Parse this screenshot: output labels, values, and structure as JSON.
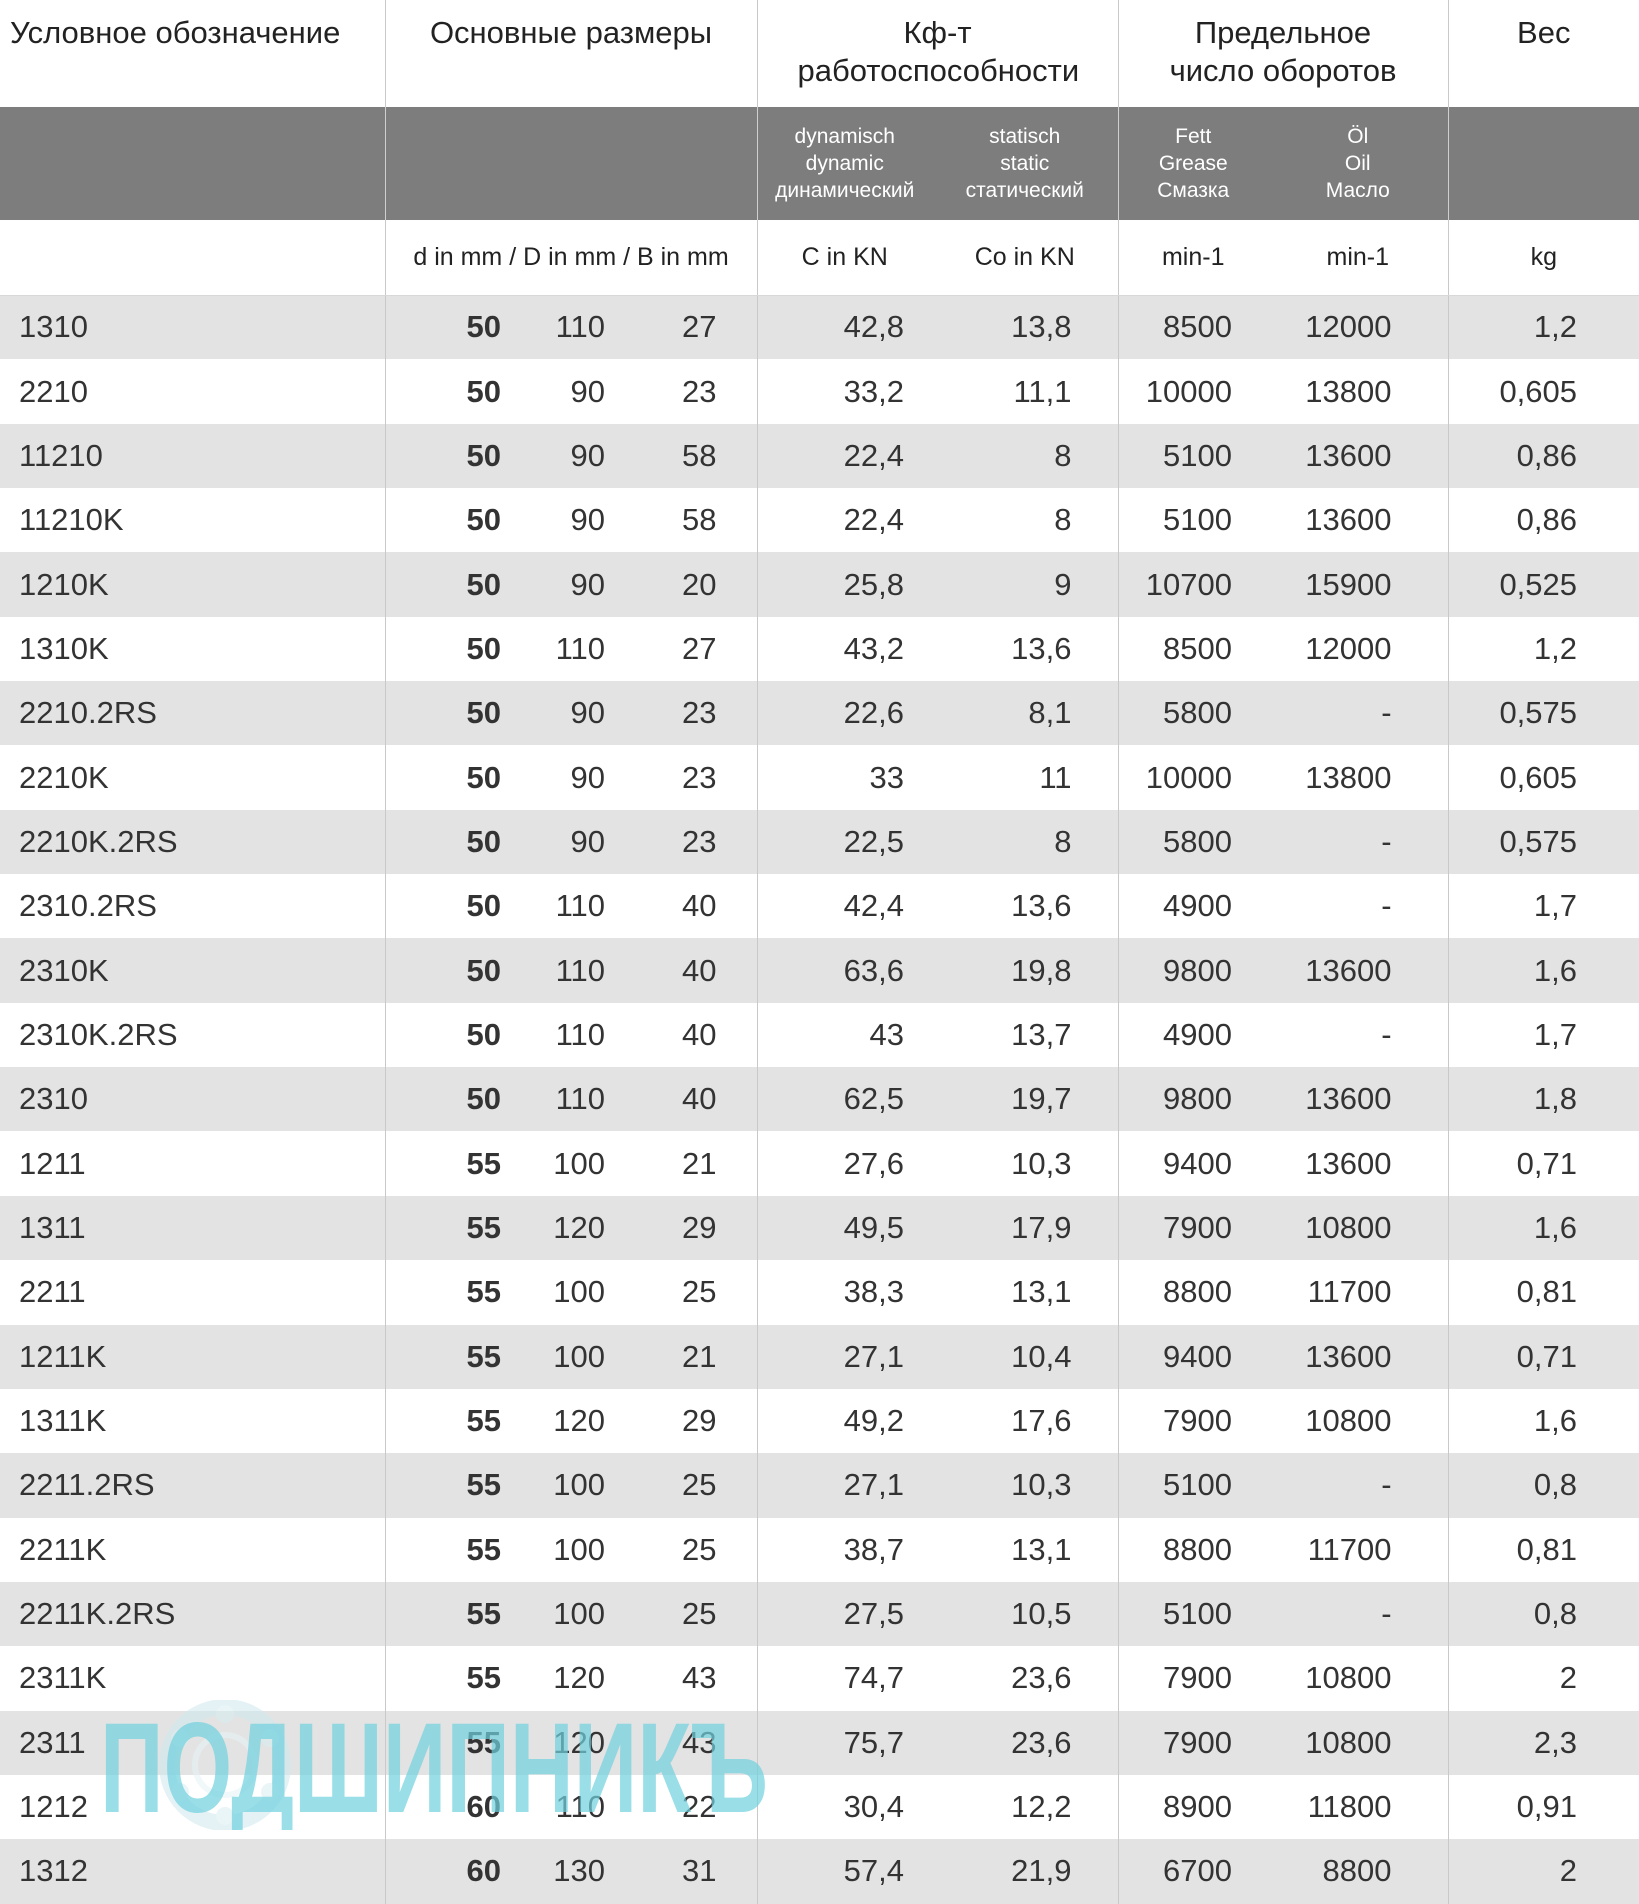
{
  "header": {
    "designation": "Условное обозначение",
    "main_dimensions": "Основные размеры",
    "load_rating": "Кф-т работоспособности",
    "speed_limit": "Предельное число оборотов",
    "weight": "Вес"
  },
  "subheader": {
    "dynamic": [
      "dynamisch",
      "dynamic",
      "динамический"
    ],
    "static": [
      "statisch",
      "static",
      "статический"
    ],
    "grease": [
      "Fett",
      "Grease",
      "Смазка"
    ],
    "oil": [
      "Öl",
      "Oil",
      "Масло"
    ]
  },
  "units": {
    "dims": "d in mm / D in mm / B in mm",
    "c": "C in KN",
    "co": "Co in KN",
    "grease": "min-1",
    "oil": "min-1",
    "weight": "kg"
  },
  "rows": [
    [
      "1310",
      "50",
      "110",
      "27",
      "42,8",
      "13,8",
      "8500",
      "12000",
      "1,2"
    ],
    [
      "2210",
      "50",
      "90",
      "23",
      "33,2",
      "11,1",
      "10000",
      "13800",
      "0,605"
    ],
    [
      "11210",
      "50",
      "90",
      "58",
      "22,4",
      "8",
      "5100",
      "13600",
      "0,86"
    ],
    [
      "11210K",
      "50",
      "90",
      "58",
      "22,4",
      "8",
      "5100",
      "13600",
      "0,86"
    ],
    [
      "1210K",
      "50",
      "90",
      "20",
      "25,8",
      "9",
      "10700",
      "15900",
      "0,525"
    ],
    [
      "1310K",
      "50",
      "110",
      "27",
      "43,2",
      "13,6",
      "8500",
      "12000",
      "1,2"
    ],
    [
      "2210.2RS",
      "50",
      "90",
      "23",
      "22,6",
      "8,1",
      "5800",
      "-",
      "0,575"
    ],
    [
      "2210K",
      "50",
      "90",
      "23",
      "33",
      "11",
      "10000",
      "13800",
      "0,605"
    ],
    [
      "2210K.2RS",
      "50",
      "90",
      "23",
      "22,5",
      "8",
      "5800",
      "-",
      "0,575"
    ],
    [
      "2310.2RS",
      "50",
      "110",
      "40",
      "42,4",
      "13,6",
      "4900",
      "-",
      "1,7"
    ],
    [
      "2310K",
      "50",
      "110",
      "40",
      "63,6",
      "19,8",
      "9800",
      "13600",
      "1,6"
    ],
    [
      "2310K.2RS",
      "50",
      "110",
      "40",
      "43",
      "13,7",
      "4900",
      "-",
      "1,7"
    ],
    [
      "2310",
      "50",
      "110",
      "40",
      "62,5",
      "19,7",
      "9800",
      "13600",
      "1,8"
    ],
    [
      "1211",
      "55",
      "100",
      "21",
      "27,6",
      "10,3",
      "9400",
      "13600",
      "0,71"
    ],
    [
      "1311",
      "55",
      "120",
      "29",
      "49,5",
      "17,9",
      "7900",
      "10800",
      "1,6"
    ],
    [
      "2211",
      "55",
      "100",
      "25",
      "38,3",
      "13,1",
      "8800",
      "11700",
      "0,81"
    ],
    [
      "1211K",
      "55",
      "100",
      "21",
      "27,1",
      "10,4",
      "9400",
      "13600",
      "0,71"
    ],
    [
      "1311K",
      "55",
      "120",
      "29",
      "49,2",
      "17,6",
      "7900",
      "10800",
      "1,6"
    ],
    [
      "2211.2RS",
      "55",
      "100",
      "25",
      "27,1",
      "10,3",
      "5100",
      "-",
      "0,8"
    ],
    [
      "2211K",
      "55",
      "100",
      "25",
      "38,7",
      "13,1",
      "8800",
      "11700",
      "0,81"
    ],
    [
      "2211K.2RS",
      "55",
      "100",
      "25",
      "27,5",
      "10,5",
      "5100",
      "-",
      "0,8"
    ],
    [
      "2311K",
      "55",
      "120",
      "43",
      "74,7",
      "23,6",
      "7900",
      "10800",
      "2"
    ],
    [
      "2311",
      "55",
      "120",
      "43",
      "75,7",
      "23,6",
      "7900",
      "10800",
      "2,3"
    ],
    [
      "1212",
      "60",
      "110",
      "22",
      "30,4",
      "12,2",
      "8900",
      "11800",
      "0,91"
    ],
    [
      "1312",
      "60",
      "130",
      "31",
      "57,4",
      "21,9",
      "6700",
      "8800",
      "2"
    ]
  ],
  "watermark": {
    "text": "ПОДШИПНИКЪ",
    "color": "#6fd0de"
  }
}
